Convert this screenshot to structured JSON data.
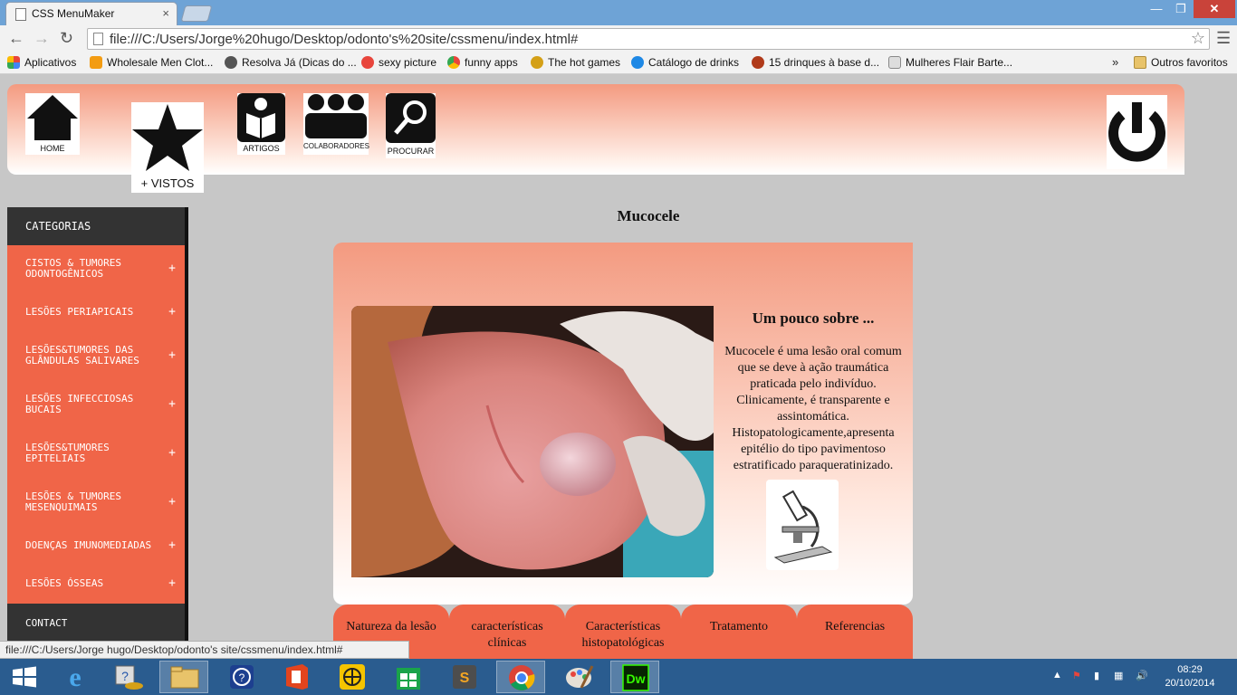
{
  "browser": {
    "tab_title": "CSS MenuMaker",
    "tab_close": "×",
    "window_buttons": {
      "minimize": "—",
      "maximize": "❐",
      "close": "✕"
    },
    "url": "file:///C:/Users/Jorge%20hugo/Desktop/odonto's%20site/cssmenu/index.html#",
    "bookmarks": [
      {
        "label": "Aplicativos",
        "color": "#e8453c"
      },
      {
        "label": "Wholesale Men Clot...",
        "color": "#f39c12"
      },
      {
        "label": "Resolva Já (Dicas do ...",
        "color": "#555555"
      },
      {
        "label": "sexy picture",
        "color": "#e8453c"
      },
      {
        "label": "funny apps",
        "color": "#4285f4"
      },
      {
        "label": "The hot games",
        "color": "#d4a017"
      },
      {
        "label": "Catálogo de drinks",
        "color": "#1e88e5"
      },
      {
        "label": "15 drinques à base d...",
        "color": "#b03a1a"
      },
      {
        "label": "Mulheres Flair Barte...",
        "color": "#888888"
      }
    ],
    "bookmarks_more": "»",
    "other_bookmarks": "Outros favoritos",
    "status_url": "file:///C:/Users/Jorge hugo/Desktop/odonto's site/cssmenu/index.html#"
  },
  "header": {
    "home_label": "HOME",
    "vistos_label": "+ VISTOS",
    "artigos_label": "ARTIGOS",
    "colaboradores_label": "COLABORADORES",
    "procurar_label": "PROCURAR"
  },
  "sidebar": {
    "heading": "CATEGORIAS",
    "plus": "+",
    "items": [
      [
        "CISTOS & TUMORES",
        "ODONTOGÊNICOS"
      ],
      [
        "LESÕES PERIAPICAIS"
      ],
      [
        "LESÕES&TUMORES DAS",
        "GLÂNDULAS SALIVARES"
      ],
      [
        "LESÕES INFECCIOSAS",
        "BUCAIS"
      ],
      [
        "LESÕES&TUMORES",
        "EPITELIAIS"
      ],
      [
        "LESÕES & TUMORES",
        "MESENQUIMAIS"
      ],
      [
        "DOENÇAS IMUNOMEDIADAS"
      ],
      [
        "LESÕES ÓSSEAS"
      ]
    ],
    "contact": "CONTACT"
  },
  "article": {
    "title": "Mucocele",
    "about_title": "Um pouco sobre ...",
    "about_text": "Mucocele é uma lesão oral comum que se deve à ação traumática praticada pelo indivíduo. Clinicamente, é transparente e assintomática. Histopatologicamente,apresenta epitélio do tipo pavimentoso estratificado paraqueratinizado."
  },
  "content_tabs": [
    [
      "Natureza da lesão"
    ],
    [
      "características",
      "clínicas"
    ],
    [
      "Características",
      "histopatológicas"
    ],
    [
      "Tratamento"
    ],
    [
      "Referencias"
    ]
  ],
  "taskbar": {
    "time": "08:29",
    "date": "20/10/2014",
    "apps": [
      "windows-start",
      "internet-explorer",
      "help-desk",
      "file-explorer",
      "help",
      "office",
      "browser-globe",
      "store",
      "sublime-text",
      "chrome",
      "paint",
      "dreamweaver"
    ],
    "dreamweaver_label": "Dw"
  },
  "colors": {
    "accent": "#f06548",
    "dark": "#333333",
    "header_gradient_top": "#f49a80"
  }
}
